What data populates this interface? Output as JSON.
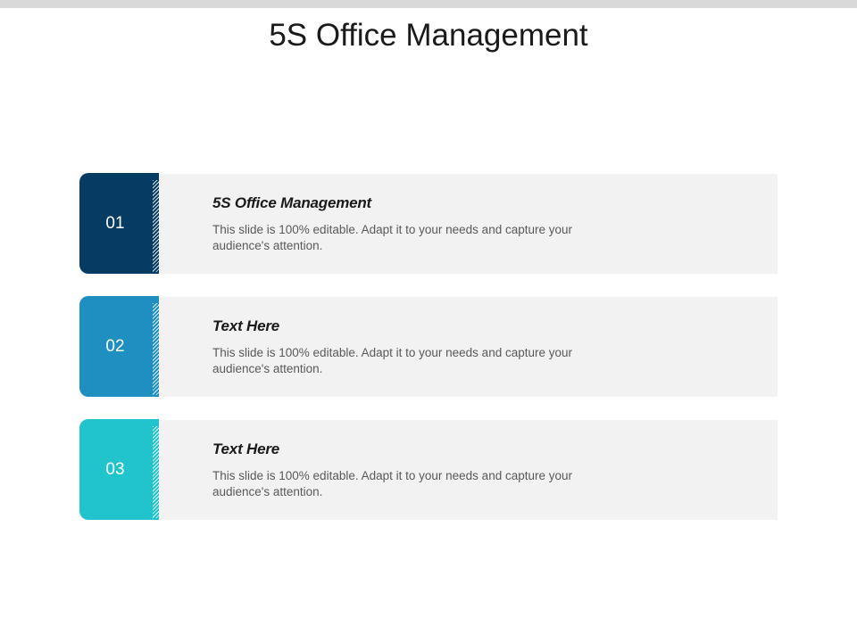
{
  "slide": {
    "title": "5S Office Management"
  },
  "rows": [
    {
      "number": "01",
      "heading": "5S Office Management",
      "text": "This slide is 100% editable. Adapt it to your needs and capture your audience's attention.",
      "color": "#063c63"
    },
    {
      "number": "02",
      "heading": "Text Here",
      "text": "This slide is 100% editable. Adapt it to your needs and capture your audience's attention.",
      "color": "#1e8fc0"
    },
    {
      "number": "03",
      "heading": "Text Here",
      "text": "This slide is 100% editable. Adapt it to your needs and capture your audience's attention.",
      "color": "#21c3cc"
    }
  ]
}
